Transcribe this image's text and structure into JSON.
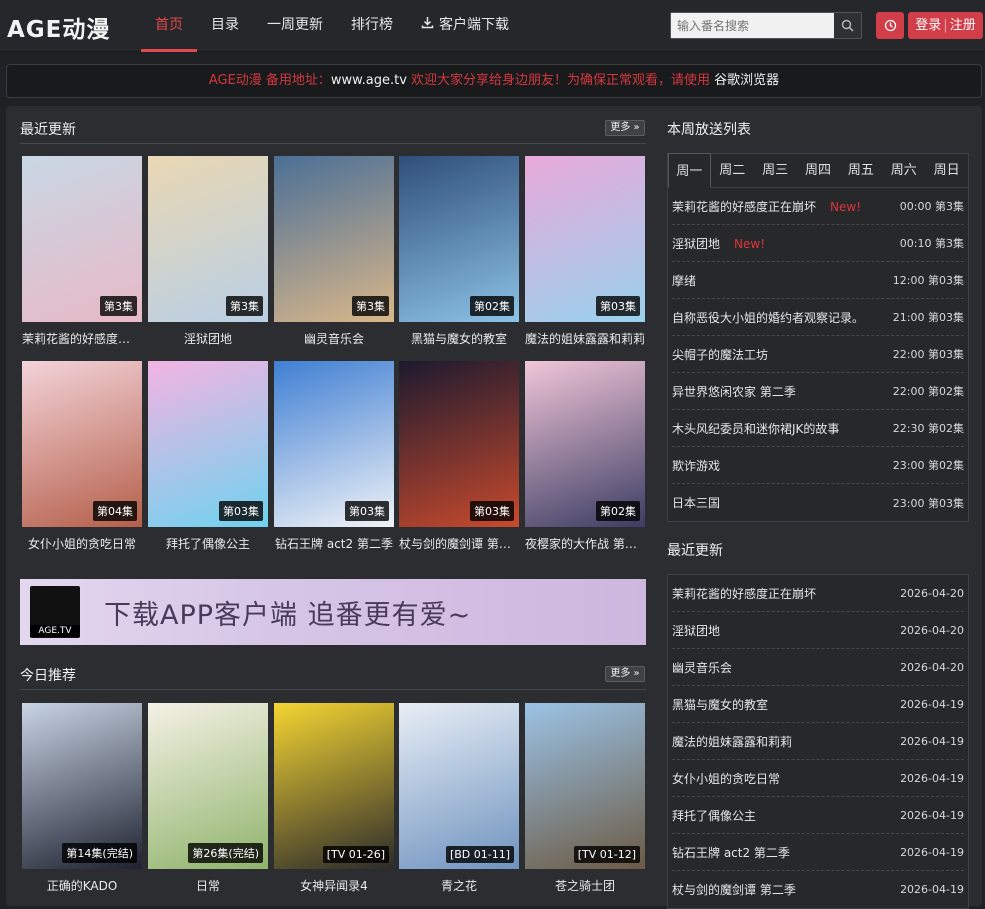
{
  "header": {
    "logo": "AGE动漫",
    "nav": [
      "首页",
      "目录",
      "一周更新",
      "排行榜",
      "客户端下载"
    ],
    "search_placeholder": "输入番名搜索",
    "login_label": "登录",
    "register_label": "注册"
  },
  "notice": {
    "part1": "AGE动漫 备用地址：",
    "url": "www.age.tv",
    "part2": " 欢迎大家分享给身边朋友！为确保正常观看，请使用 ",
    "browser": "谷歌浏览器"
  },
  "recent": {
    "title": "最近更新",
    "more": "更多 »",
    "items": [
      {
        "title": "茉莉花酱的好感度正在崩坏",
        "ep": "第3集",
        "c1": "#c9d7e4",
        "c2": "#e7b9c6"
      },
      {
        "title": "淫狱团地",
        "ep": "第3集",
        "c1": "#e9d8b4",
        "c2": "#b9cfe4"
      },
      {
        "title": "幽灵音乐会",
        "ep": "第3集",
        "c1": "#4a6f96",
        "c2": "#d9b78a"
      },
      {
        "title": "黑猫与魔女的教室",
        "ep": "第02集",
        "c1": "#2f4f7a",
        "c2": "#8dc2e6"
      },
      {
        "title": "魔法的姐妹露露和莉莉",
        "ep": "第03集",
        "c1": "#e8a9d9",
        "c2": "#9ad2ee"
      },
      {
        "title": "女仆小姐的贪吃日常",
        "ep": "第04集",
        "c1": "#f3d3da",
        "c2": "#b55f49"
      },
      {
        "title": "拜托了偶像公主",
        "ep": "第03集",
        "c1": "#f3b4e2",
        "c2": "#6fd2ef"
      },
      {
        "title": "钻石王牌 act2 第二季",
        "ep": "第03集",
        "c1": "#3f7fd3",
        "c2": "#f0f3f7"
      },
      {
        "title": "杖与剑的魔剑谭 第二季",
        "ep": "第03集",
        "c1": "#1c1a2e",
        "c2": "#c84a2d"
      },
      {
        "title": "夜樱家的大作战 第二季",
        "ep": "第02集",
        "c1": "#f1c6d8",
        "c2": "#3b3d63"
      }
    ]
  },
  "banner": {
    "text": "下载APP客户端 追番更有爱~",
    "logo_label": "AGE.TV"
  },
  "recommend": {
    "title": "今日推荐",
    "more": "更多 »",
    "items": [
      {
        "title": "正确的KADO",
        "ep": "第14集(完结)",
        "c1": "#c9d4e4",
        "c2": "#1e2230"
      },
      {
        "title": "日常",
        "ep": "第26集(完结)",
        "c1": "#f4f1e6",
        "c2": "#8fb36a"
      },
      {
        "title": "女神异闻录4",
        "ep": "[TV 01-26]",
        "c1": "#f5d532",
        "c2": "#2b2b2b"
      },
      {
        "title": "青之花",
        "ep": "[BD 01-11]",
        "c1": "#e8eef5",
        "c2": "#6e93bf"
      },
      {
        "title": "苍之骑士团",
        "ep": "[TV 01-12]",
        "c1": "#9bc3e6",
        "c2": "#6b5a44"
      }
    ]
  },
  "schedule": {
    "title": "本周放送列表",
    "days": [
      "周一",
      "周二",
      "周三",
      "周四",
      "周五",
      "周六",
      "周日"
    ],
    "rows": [
      {
        "name": "茉莉花酱的好感度正在崩坏",
        "new": "New!",
        "time": "00:00 第3集"
      },
      {
        "name": "淫狱团地",
        "new": "New!",
        "time": "00:10 第3集"
      },
      {
        "name": "摩绪",
        "new": "",
        "time": "12:00 第03集"
      },
      {
        "name": "自称恶役大小姐的婚约者观察记录。",
        "new": "",
        "time": "21:00 第03集"
      },
      {
        "name": "尖帽子的魔法工坊",
        "new": "",
        "time": "22:00 第03集"
      },
      {
        "name": "异世界悠闲农家 第二季",
        "new": "",
        "time": "22:00 第02集"
      },
      {
        "name": "木头风纪委员和迷你裙JK的故事",
        "new": "",
        "time": "22:30 第02集"
      },
      {
        "name": "欺诈游戏",
        "new": "",
        "time": "23:00 第02集"
      },
      {
        "name": "日本三国",
        "new": "",
        "time": "23:00 第03集"
      }
    ]
  },
  "latest": {
    "title": "最近更新",
    "rows": [
      {
        "name": "茉莉花酱的好感度正在崩坏",
        "date": "2026-04-20"
      },
      {
        "name": "淫狱团地",
        "date": "2026-04-20"
      },
      {
        "name": "幽灵音乐会",
        "date": "2026-04-20"
      },
      {
        "name": "黑猫与魔女的教室",
        "date": "2026-04-19"
      },
      {
        "name": "魔法的姐妹露露和莉莉",
        "date": "2026-04-19"
      },
      {
        "name": "女仆小姐的贪吃日常",
        "date": "2026-04-19"
      },
      {
        "name": "拜托了偶像公主",
        "date": "2026-04-19"
      },
      {
        "name": "钻石王牌 act2 第二季",
        "date": "2026-04-19"
      },
      {
        "name": "杖与剑的魔剑谭 第二季",
        "date": "2026-04-19"
      }
    ]
  }
}
